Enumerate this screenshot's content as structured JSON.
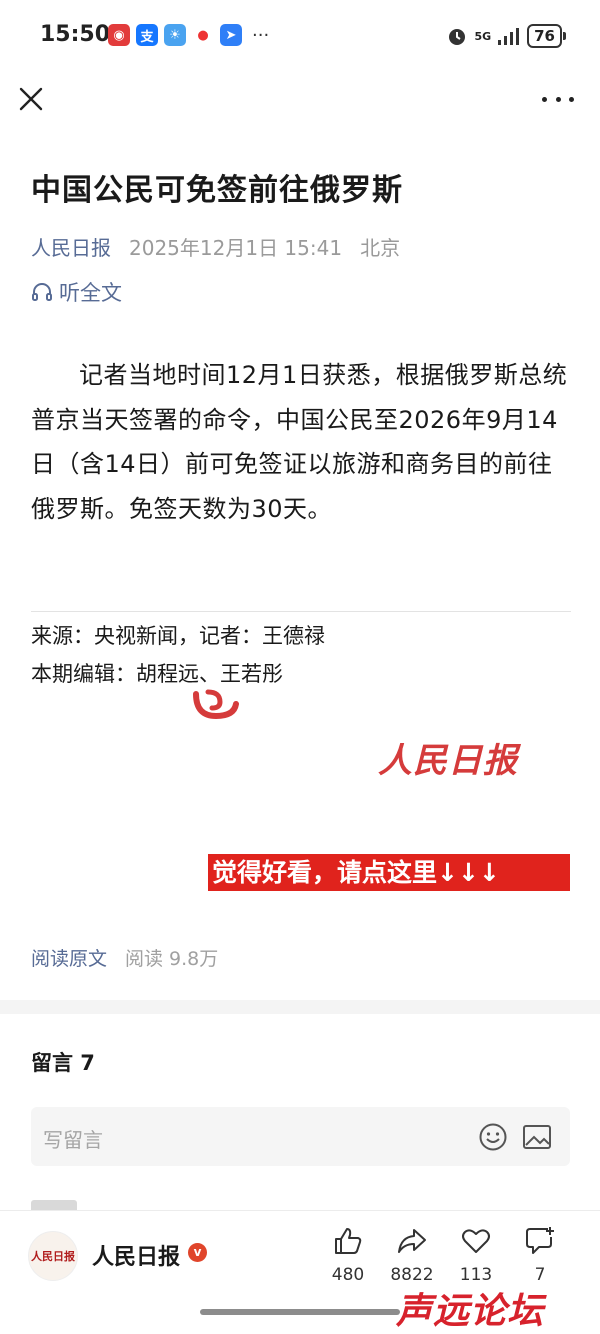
{
  "status_bar": {
    "time": "15:50",
    "network": "5G",
    "battery": "76"
  },
  "article": {
    "title": "中国公民可免签前往俄罗斯",
    "author": "人民日报",
    "datetime": "2025年12月1日 15:41",
    "location": "北京",
    "listen_label": "听全文",
    "body": "记者当地时间12月1日获悉，根据俄罗斯总统普京当天签署的命令，中国公民至2026年9月14日（含14日）前可免签证以旅游和商务目的前往俄罗斯。免签天数为30天。",
    "source_line": "来源：央视新闻，记者：王德禄",
    "editor_line": "本期编辑：胡程远、王若彤"
  },
  "brand_logo_text": "人民日报",
  "promo_banner": "觉得好看，请点这里↓↓↓",
  "read_stats": {
    "read_original": "阅读原文",
    "read_count": "阅读 9.8万"
  },
  "comments": {
    "title": "留言 7",
    "placeholder": "写留言"
  },
  "account": {
    "name": "人民日报",
    "avatar_text": "人民日报",
    "verified_mark": "v"
  },
  "actions": {
    "like_count": "480",
    "share_count": "8822",
    "favorite_count": "113",
    "comment_count": "7"
  },
  "watermark": "声远论坛",
  "colors": {
    "link_blue": "#576b95",
    "brand_red": "#e0231d"
  }
}
